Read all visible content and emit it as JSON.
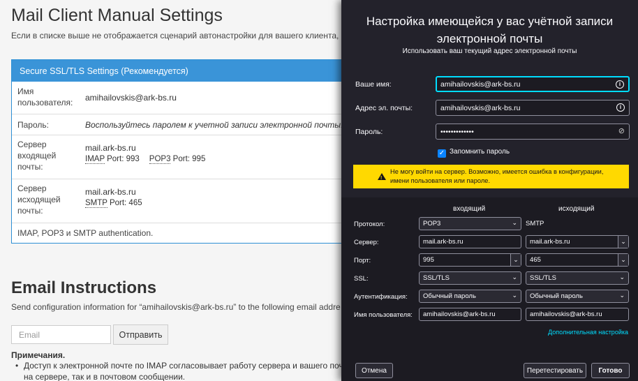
{
  "web": {
    "title": "Mail Client Manual Settings",
    "subtitle": "Если в списке выше не отображается сценарий автонастройки для вашего клиента, можн",
    "panel_title": "Secure SSL/TLS Settings (Рекомендуется)",
    "rows": {
      "username_label": "Имя пользователя:",
      "username_value": "amihailovskis@ark-bs.ru",
      "password_label": "Пароль:",
      "password_value": "Воспользуйтесь паролем к учетной записи электронной почты.",
      "incoming_label": "Сервер входящей почты:",
      "incoming_host": "mail.ark-bs.ru",
      "imap": "IMAP",
      "imap_port": " Port: 993",
      "pop3": "POP3",
      "pop3_port": " Port: 995",
      "outgoing_label": "Сервер исходящей почты:",
      "outgoing_host": "mail.ark-bs.ru",
      "smtp": "SMTP",
      "smtp_port": " Port: 465",
      "auth_note": "IMAP, POP3 и SMTP authentication."
    },
    "email_title": "Email Instructions",
    "email_sub": "Send configuration information for “amihailovskis@ark-bs.ru” to the following email addre",
    "email_placeholder": "Email",
    "send_label": "Отправить",
    "notes_heading": "Примечания.",
    "note_1": "Доступ к электронной почте по IMAP согласовывает работу сервера и вашего почт на сервере, так и в почтовом сообщении."
  },
  "dialog": {
    "title": "Настройка имеющейся у вас учётной записи электронной почты",
    "subtitle": "Использовать ваш текущий адрес электронной почты",
    "name_label": "Ваше имя:",
    "name_value": "amihailovskis@ark-bs.ru",
    "email_label": "Адрес эл. почты:",
    "email_value": "amihailovskis@ark-bs.ru",
    "password_label": "Пароль:",
    "password_value": "•••••••••••••",
    "remember_label": "Запомнить пароль",
    "warning": "Не могу войти на сервер. Возможно, имеется ошибка в конфигурации, имени пользователя или пароле.",
    "col_incoming": "входящий",
    "col_outgoing": "исходящий",
    "protocol_label": "Протокол:",
    "protocol_in": "POP3",
    "protocol_out": "SMTP",
    "server_label": "Сервер:",
    "server_in": "mail.ark-bs.ru",
    "server_out": "mail.ark-bs.ru",
    "port_label": "Порт:",
    "port_in": "995",
    "port_out": "465",
    "ssl_label": "SSL:",
    "ssl_in": "SSL/TLS",
    "ssl_out": "SSL/TLS",
    "auth_label": "Аутентификация:",
    "auth_in": "Обычный пароль",
    "auth_out": "Обычный пароль",
    "user_label": "Имя пользователя:",
    "user_in": "amihailovskis@ark-bs.ru",
    "user_out": "amihailovskis@ark-bs.ru",
    "advanced_link": "Дополнительная настройка",
    "cancel_label": "Отмена",
    "retest_label": "Перетестировать",
    "done_label": "Готово"
  },
  "colors": {
    "accent": "#3a94d8",
    "warning": "#ffd900",
    "dialog_bg": "#1c1b22",
    "focus": "#00ddff"
  }
}
